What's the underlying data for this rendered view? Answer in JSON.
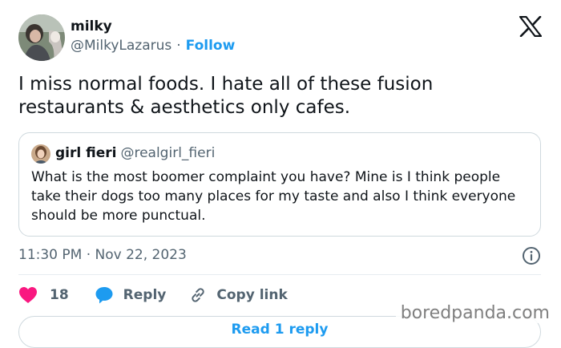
{
  "tweet": {
    "display_name": "milky",
    "handle": "@MilkyLazarus",
    "separator": "·",
    "follow_label": "Follow",
    "text": "I miss normal foods. I hate all of these fusion restaurants & aesthetics only cafes.",
    "timestamp": "11:30 PM · Nov 22, 2023",
    "logo_icon": "x-logo-icon"
  },
  "quote": {
    "display_name": "girl fieri",
    "handle": "@realgirl_fieri",
    "text": "What is the most boomer complaint you have? Mine is I think people take their dogs too many places for my taste and also I think everyone should be more punctual."
  },
  "actions": {
    "like_count": "18",
    "reply_label": "Reply",
    "copy_link_label": "Copy link"
  },
  "bottom_card": {
    "label": "Read 1 reply"
  },
  "watermark": "boredpanda.com",
  "colors": {
    "link": "#1d9bf0",
    "like": "#f91880",
    "reply": "#1d9bf0",
    "text": "#0f1419",
    "secondary": "#536471",
    "border": "#cfd9de"
  }
}
